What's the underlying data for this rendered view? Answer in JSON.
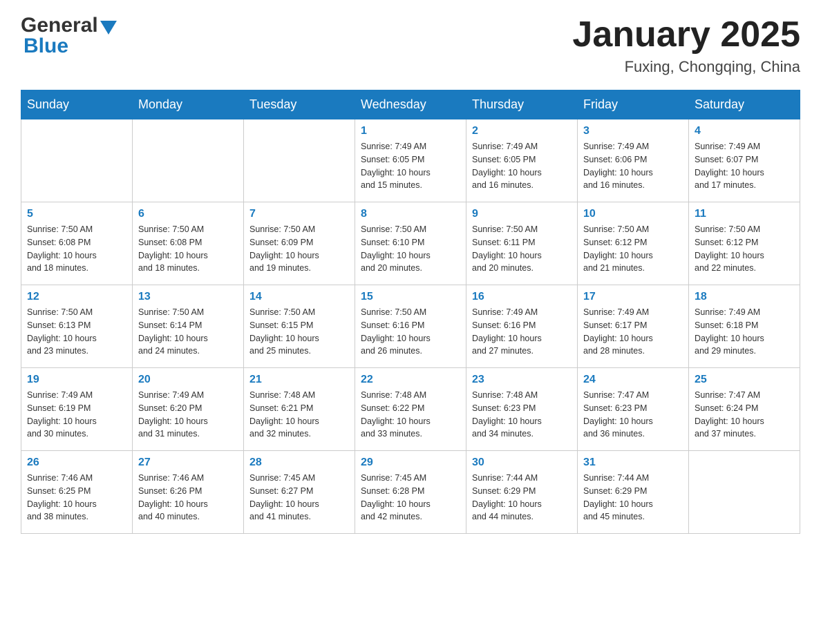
{
  "logo": {
    "general": "General",
    "blue": "Blue"
  },
  "title": "January 2025",
  "location": "Fuxing, Chongqing, China",
  "days_of_week": [
    "Sunday",
    "Monday",
    "Tuesday",
    "Wednesday",
    "Thursday",
    "Friday",
    "Saturday"
  ],
  "weeks": [
    [
      {
        "day": "",
        "info": ""
      },
      {
        "day": "",
        "info": ""
      },
      {
        "day": "",
        "info": ""
      },
      {
        "day": "1",
        "info": "Sunrise: 7:49 AM\nSunset: 6:05 PM\nDaylight: 10 hours\nand 15 minutes."
      },
      {
        "day": "2",
        "info": "Sunrise: 7:49 AM\nSunset: 6:05 PM\nDaylight: 10 hours\nand 16 minutes."
      },
      {
        "day": "3",
        "info": "Sunrise: 7:49 AM\nSunset: 6:06 PM\nDaylight: 10 hours\nand 16 minutes."
      },
      {
        "day": "4",
        "info": "Sunrise: 7:49 AM\nSunset: 6:07 PM\nDaylight: 10 hours\nand 17 minutes."
      }
    ],
    [
      {
        "day": "5",
        "info": "Sunrise: 7:50 AM\nSunset: 6:08 PM\nDaylight: 10 hours\nand 18 minutes."
      },
      {
        "day": "6",
        "info": "Sunrise: 7:50 AM\nSunset: 6:08 PM\nDaylight: 10 hours\nand 18 minutes."
      },
      {
        "day": "7",
        "info": "Sunrise: 7:50 AM\nSunset: 6:09 PM\nDaylight: 10 hours\nand 19 minutes."
      },
      {
        "day": "8",
        "info": "Sunrise: 7:50 AM\nSunset: 6:10 PM\nDaylight: 10 hours\nand 20 minutes."
      },
      {
        "day": "9",
        "info": "Sunrise: 7:50 AM\nSunset: 6:11 PM\nDaylight: 10 hours\nand 20 minutes."
      },
      {
        "day": "10",
        "info": "Sunrise: 7:50 AM\nSunset: 6:12 PM\nDaylight: 10 hours\nand 21 minutes."
      },
      {
        "day": "11",
        "info": "Sunrise: 7:50 AM\nSunset: 6:12 PM\nDaylight: 10 hours\nand 22 minutes."
      }
    ],
    [
      {
        "day": "12",
        "info": "Sunrise: 7:50 AM\nSunset: 6:13 PM\nDaylight: 10 hours\nand 23 minutes."
      },
      {
        "day": "13",
        "info": "Sunrise: 7:50 AM\nSunset: 6:14 PM\nDaylight: 10 hours\nand 24 minutes."
      },
      {
        "day": "14",
        "info": "Sunrise: 7:50 AM\nSunset: 6:15 PM\nDaylight: 10 hours\nand 25 minutes."
      },
      {
        "day": "15",
        "info": "Sunrise: 7:50 AM\nSunset: 6:16 PM\nDaylight: 10 hours\nand 26 minutes."
      },
      {
        "day": "16",
        "info": "Sunrise: 7:49 AM\nSunset: 6:16 PM\nDaylight: 10 hours\nand 27 minutes."
      },
      {
        "day": "17",
        "info": "Sunrise: 7:49 AM\nSunset: 6:17 PM\nDaylight: 10 hours\nand 28 minutes."
      },
      {
        "day": "18",
        "info": "Sunrise: 7:49 AM\nSunset: 6:18 PM\nDaylight: 10 hours\nand 29 minutes."
      }
    ],
    [
      {
        "day": "19",
        "info": "Sunrise: 7:49 AM\nSunset: 6:19 PM\nDaylight: 10 hours\nand 30 minutes."
      },
      {
        "day": "20",
        "info": "Sunrise: 7:49 AM\nSunset: 6:20 PM\nDaylight: 10 hours\nand 31 minutes."
      },
      {
        "day": "21",
        "info": "Sunrise: 7:48 AM\nSunset: 6:21 PM\nDaylight: 10 hours\nand 32 minutes."
      },
      {
        "day": "22",
        "info": "Sunrise: 7:48 AM\nSunset: 6:22 PM\nDaylight: 10 hours\nand 33 minutes."
      },
      {
        "day": "23",
        "info": "Sunrise: 7:48 AM\nSunset: 6:23 PM\nDaylight: 10 hours\nand 34 minutes."
      },
      {
        "day": "24",
        "info": "Sunrise: 7:47 AM\nSunset: 6:23 PM\nDaylight: 10 hours\nand 36 minutes."
      },
      {
        "day": "25",
        "info": "Sunrise: 7:47 AM\nSunset: 6:24 PM\nDaylight: 10 hours\nand 37 minutes."
      }
    ],
    [
      {
        "day": "26",
        "info": "Sunrise: 7:46 AM\nSunset: 6:25 PM\nDaylight: 10 hours\nand 38 minutes."
      },
      {
        "day": "27",
        "info": "Sunrise: 7:46 AM\nSunset: 6:26 PM\nDaylight: 10 hours\nand 40 minutes."
      },
      {
        "day": "28",
        "info": "Sunrise: 7:45 AM\nSunset: 6:27 PM\nDaylight: 10 hours\nand 41 minutes."
      },
      {
        "day": "29",
        "info": "Sunrise: 7:45 AM\nSunset: 6:28 PM\nDaylight: 10 hours\nand 42 minutes."
      },
      {
        "day": "30",
        "info": "Sunrise: 7:44 AM\nSunset: 6:29 PM\nDaylight: 10 hours\nand 44 minutes."
      },
      {
        "day": "31",
        "info": "Sunrise: 7:44 AM\nSunset: 6:29 PM\nDaylight: 10 hours\nand 45 minutes."
      },
      {
        "day": "",
        "info": ""
      }
    ]
  ]
}
